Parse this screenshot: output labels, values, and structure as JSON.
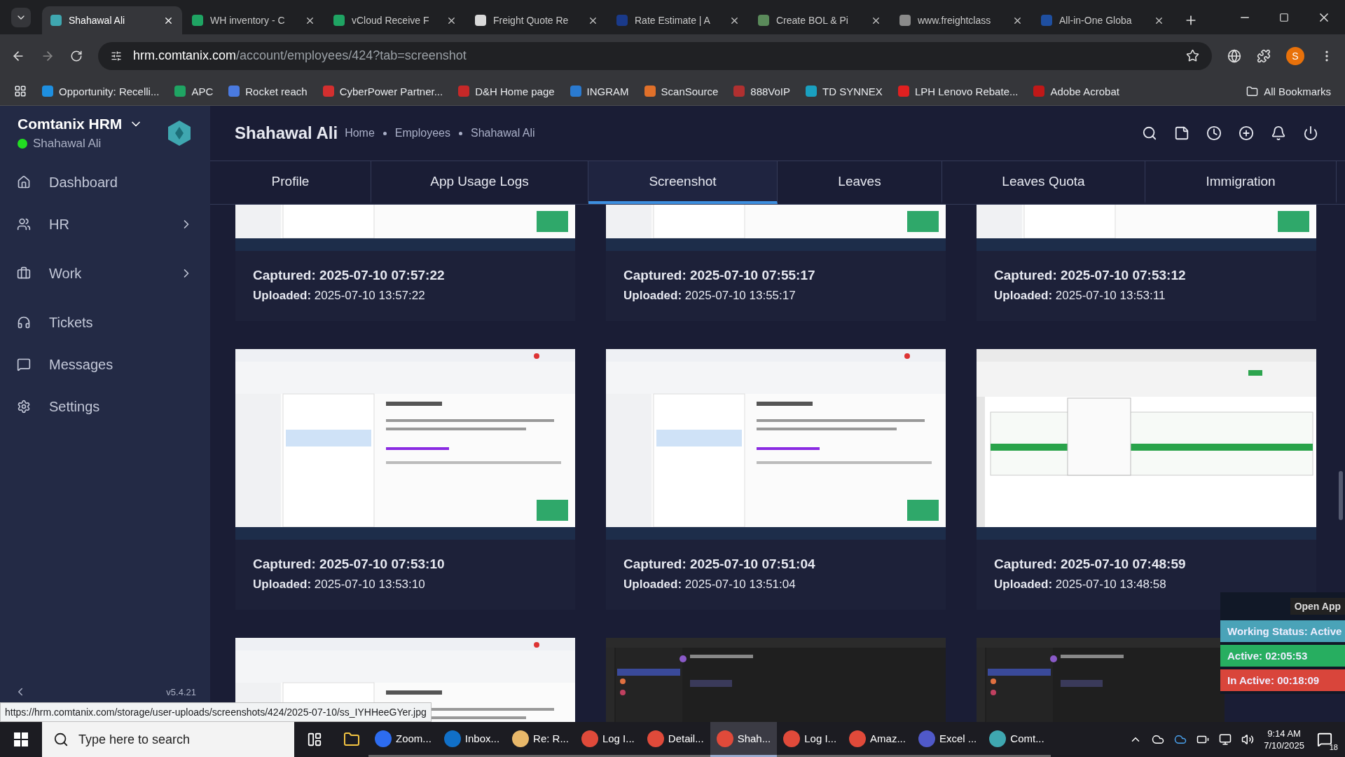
{
  "browser": {
    "tabs": [
      {
        "title": "Shahawal Ali",
        "selected": true,
        "color": "#3fa7b0"
      },
      {
        "title": "WH inventory - C",
        "selected": false,
        "color": "#1fa463"
      },
      {
        "title": "vCloud Receive F",
        "selected": false,
        "color": "#1fa463"
      },
      {
        "title": "Freight Quote Re",
        "selected": false,
        "color": "#d9d9d9"
      },
      {
        "title": "Rate Estimate | A",
        "selected": false,
        "color": "#1a3a8a"
      },
      {
        "title": "Create BOL & Pi",
        "selected": false,
        "color": "#5a8a5a"
      },
      {
        "title": "www.freightclass",
        "selected": false,
        "color": "#8a8a8a"
      },
      {
        "title": "All-in-One Globa",
        "selected": false,
        "color": "#1f4fa0"
      }
    ],
    "address": {
      "host": "hrm.comtanix.com",
      "path": "/account/employees/424?tab=screenshot"
    },
    "profile_initial": "S",
    "bookmarks": [
      {
        "label": "Opportunity: Recelli...",
        "color": "#1e8fe0"
      },
      {
        "label": "APC",
        "color": "#1fa463"
      },
      {
        "label": "Rocket reach",
        "color": "#4a7ae0"
      },
      {
        "label": "CyberPower Partner...",
        "color": "#d32f2f"
      },
      {
        "label": "D&H Home page",
        "color": "#c62828"
      },
      {
        "label": "INGRAM",
        "color": "#2a7ad0"
      },
      {
        "label": "ScanSource",
        "color": "#e0702a"
      },
      {
        "label": "888VoIP",
        "color": "#b03030"
      },
      {
        "label": "TD SYNNEX",
        "color": "#1aa0c0"
      },
      {
        "label": "LPH Lenovo Rebate...",
        "color": "#e02020"
      },
      {
        "label": "Adobe Acrobat",
        "color": "#c01818"
      }
    ],
    "all_bookmarks": "All Bookmarks"
  },
  "sidebar": {
    "app_name": "Comtanix HRM",
    "user": "Shahawal Ali",
    "online": true,
    "items": [
      {
        "label": "Dashboard",
        "kind": "home",
        "expandable": false
      },
      {
        "label": "HR",
        "kind": "people",
        "expandable": true
      },
      {
        "label": "Work",
        "kind": "briefcase",
        "expandable": true
      },
      {
        "label": "Tickets",
        "kind": "headset",
        "expandable": false
      },
      {
        "label": "Messages",
        "kind": "message",
        "expandable": false
      },
      {
        "label": "Settings",
        "kind": "gear",
        "expandable": false
      }
    ],
    "version": "v5.4.21"
  },
  "header": {
    "title": "Shahawal Ali",
    "breadcrumb": [
      "Home",
      "Employees",
      "Shahawal Ali"
    ]
  },
  "tabs": [
    {
      "label": "Profile",
      "selected": false
    },
    {
      "label": "App Usage Logs",
      "selected": false
    },
    {
      "label": "Screenshot",
      "selected": true
    },
    {
      "label": "Leaves",
      "selected": false
    },
    {
      "label": "Leaves Quota",
      "selected": false
    },
    {
      "label": "Immigration",
      "selected": false
    }
  ],
  "screenshots": [
    {
      "kind": "mail",
      "captured": "Captured: 2025-07-10 07:57:22",
      "uploaded": "**Uploaded:** 2025-07-10 13:57:22"
    },
    {
      "kind": "mail",
      "captured": "Captured: 2025-07-10 07:55:17",
      "uploaded": "**Uploaded:** 2025-07-10 13:55:17"
    },
    {
      "kind": "mail",
      "captured": "Captured: 2025-07-10 07:53:12",
      "uploaded": "**Uploaded:** 2025-07-10 13:53:11"
    },
    {
      "kind": "mail",
      "captured": "Captured: 2025-07-10 07:53:10",
      "uploaded": "**Uploaded:** 2025-07-10 13:53:10"
    },
    {
      "kind": "mail",
      "captured": "Captured: 2025-07-10 07:51:04",
      "uploaded": "**Uploaded:** 2025-07-10 13:51:04"
    },
    {
      "kind": "sheet",
      "captured": "Captured: 2025-07-10 07:48:59",
      "uploaded": "**Uploaded:** 2025-07-10 13:48:58"
    },
    {
      "kind": "mail"
    },
    {
      "kind": "chat"
    },
    {
      "kind": "chat"
    }
  ],
  "status_url": "https://hrm.comtanix.com/storage/user-uploads/screenshots/424/2025-07-10/ss_IYHHeeGYer.jpg",
  "tracker": {
    "open_app": "Open App",
    "rows": [
      {
        "text": "Working Status: Active",
        "color": "#4aa3b8"
      },
      {
        "text": "Active: 02:05:53",
        "color": "#27ae60"
      },
      {
        "text": "In Active: 00:18:09",
        "color": "#d9453b"
      }
    ]
  },
  "taskbar": {
    "search_placeholder": "Type here to search",
    "apps": [
      {
        "label": "Zoom...",
        "selected": false,
        "color": "#2d6cf0"
      },
      {
        "label": "Inbox...",
        "selected": false,
        "color": "#1170c8"
      },
      {
        "label": "Re: R...",
        "selected": false,
        "color": "#e8b86a"
      },
      {
        "label": "Log I...",
        "selected": false,
        "color": "#e04a3a"
      },
      {
        "label": "Detail...",
        "selected": false,
        "color": "#e04a3a"
      },
      {
        "label": "Shah...",
        "selected": true,
        "color": "#e04a3a"
      },
      {
        "label": "Log I...",
        "selected": false,
        "color": "#e04a3a"
      },
      {
        "label": "Amaz...",
        "selected": false,
        "color": "#e04a3a"
      },
      {
        "label": "Excel ...",
        "selected": false,
        "color": "#5059c9"
      },
      {
        "label": "Comt...",
        "selected": false,
        "color": "#3fa7b0"
      }
    ],
    "time": "9:14 AM",
    "date": "7/10/2025",
    "notifications": "18"
  }
}
